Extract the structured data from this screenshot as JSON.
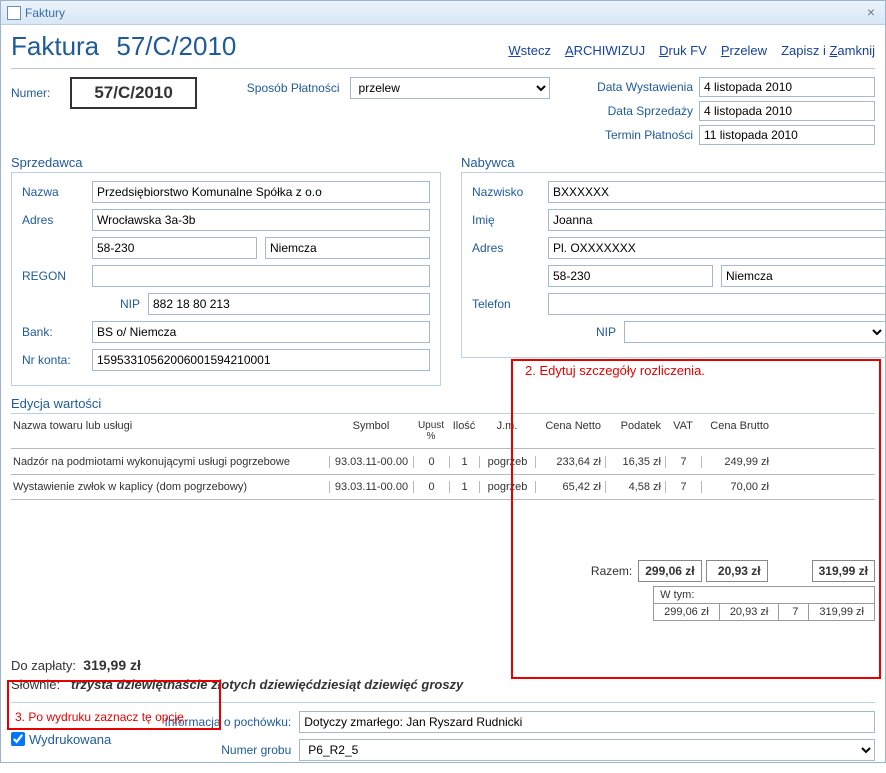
{
  "window": {
    "title": "Faktury"
  },
  "header": {
    "title": "Faktura",
    "number": "57/C/2010",
    "actions": {
      "back": "Wstecz",
      "archive": "ARCHIWIZUJ",
      "print": "Druk FV",
      "transfer": "Przelew",
      "save_close": "Zapisz i Zamknij"
    }
  },
  "fields": {
    "numer_label": "Numer:",
    "numer_value": "57/C/2010",
    "sposob_label": "Sposób Płatności",
    "sposob_value": "przelew"
  },
  "dates": {
    "wyst_label": "Data Wystawienia",
    "wyst_value": "4 listopada 2010",
    "sprz_label": "Data Sprzedaży",
    "sprz_value": "4 listopada 2010",
    "termin_label": "Termin Płatności",
    "termin_value": "11 listopada 2010"
  },
  "seller": {
    "title": "Sprzedawca",
    "nazwa_label": "Nazwa",
    "nazwa": "Przedsiębiorstwo Komunalne Spółka z o.o",
    "adres_label": "Adres",
    "adres": "Wrocławska 3a-3b",
    "kod": "58-230",
    "miasto": "Niemcza",
    "regon_label": "REGON",
    "regon": "",
    "nip_label": "NIP",
    "nip": "882 18 80 213",
    "bank_label": "Bank:",
    "bank": "BS o/ Niemcza",
    "konto_label": "Nr konta:",
    "konto": "15953310562006001594210001"
  },
  "buyer": {
    "title": "Nabywca",
    "nazwisko_label": "Nazwisko",
    "nazwisko": "BXXXXXX",
    "imie_label": "Imię",
    "imie": "Joanna",
    "adres_label": "Adres",
    "adres": "Pl. OXXXXXXX",
    "kod": "58-230",
    "miasto": "Niemcza",
    "telefon_label": "Telefon",
    "telefon": "",
    "nip_label": "NIP",
    "nip": ""
  },
  "annotations": {
    "a2": "2. Edytuj szczegóły rozliczenia.",
    "a3": "3. Po wydruku zaznacz tę opcję."
  },
  "grid": {
    "title": "Edycja wartości",
    "headers": {
      "name": "Nazwa towaru lub usługi",
      "symbol": "Symbol",
      "upust": "Upust %",
      "ilosc": "Ilość",
      "jm": "J.m.",
      "netto": "Cena Netto",
      "podatek": "Podatek",
      "vat": "VAT",
      "brutto": "Cena Brutto"
    },
    "rows": [
      {
        "name": "Nadzór na podmiotami wykonującymi usługi pogrzebowe",
        "symbol": "93.03.11-00.00",
        "upust": "0",
        "ilosc": "1",
        "jm": "pogrzeb",
        "netto": "233,64 zł",
        "podatek": "16,35 zł",
        "vat": "7",
        "brutto": "249,99 zł"
      },
      {
        "name": "Wystawienie zwłok w kaplicy (dom pogrzebowy)",
        "symbol": "93.03.11-00.00",
        "upust": "0",
        "ilosc": "1",
        "jm": "pogrzeb",
        "netto": "65,42 zł",
        "podatek": "4,58 zł",
        "vat": "7",
        "brutto": "70,00 zł"
      }
    ]
  },
  "totals": {
    "razem_label": "Razem:",
    "netto": "299,06 zł",
    "podatek": "20,93 zł",
    "brutto": "319,99 zł",
    "wtym_label": "W tym:",
    "wtym": {
      "netto": "299,06 zł",
      "podatek": "20,93 zł",
      "vat": "7",
      "brutto": "319,99 zł"
    }
  },
  "summary": {
    "do_zaplaty_label": "Do zapłaty:",
    "do_zaplaty": "319,99 zł",
    "slownie_label": "Słownie:",
    "slownie": "trzysta dziewiętnaście złotych dziewięćdziesiąt dziewięć groszy"
  },
  "footer": {
    "printed_label": "Wydrukowana",
    "info_label": "Informacja o pochówku:",
    "info_value": "Dotyczy zmarłego: Jan Ryszard Rudnicki",
    "grave_label": "Numer grobu",
    "grave_value": "P6_R2_5"
  }
}
